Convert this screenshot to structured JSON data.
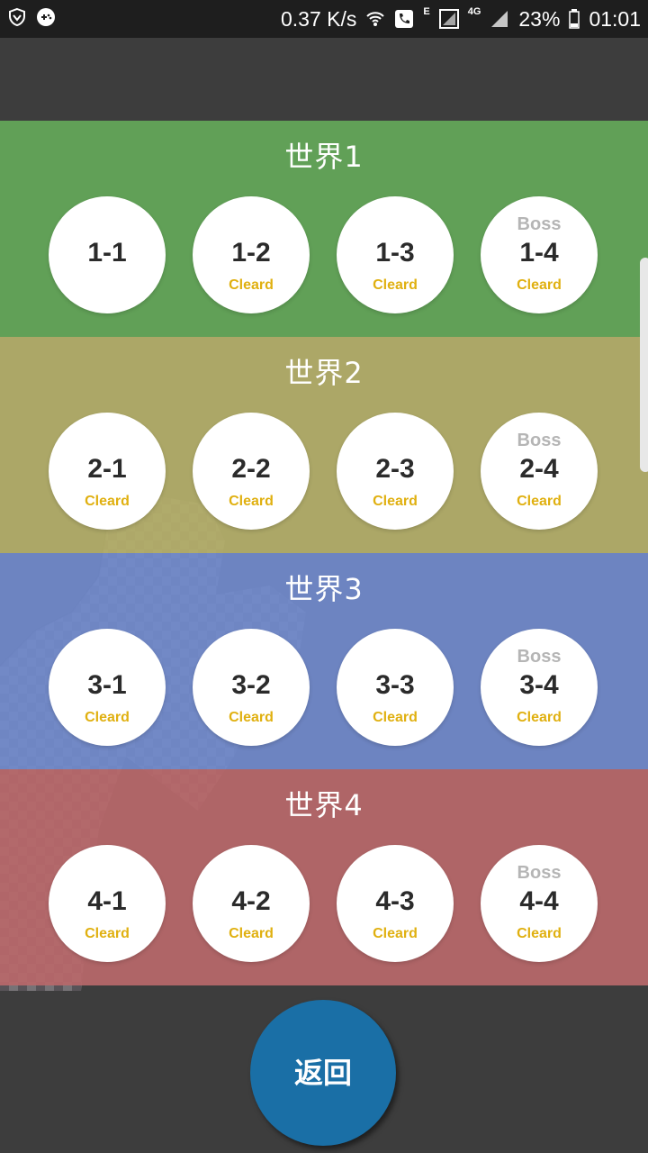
{
  "status_bar": {
    "net_speed": "0.37 K/s",
    "network_e": "E",
    "network_4g": "4G",
    "battery": "23%",
    "time": "01:01",
    "icons": [
      "shield-icon",
      "game-icon",
      "wifi-icon",
      "call-icon",
      "signal-icon",
      "signal-4g-icon",
      "battery-icon"
    ]
  },
  "colors": {
    "world1": "#61a057",
    "world2": "#b5b06a",
    "world3": "#728ccf",
    "world4": "#b8686a",
    "cleared": "#e0b010",
    "back_button": "#1a6fa6"
  },
  "worlds": [
    {
      "title": "世界1",
      "stages": [
        {
          "label": "1-1",
          "boss": "",
          "status": ""
        },
        {
          "label": "1-2",
          "boss": "",
          "status": "Cleard"
        },
        {
          "label": "1-3",
          "boss": "",
          "status": "Cleard"
        },
        {
          "label": "1-4",
          "boss": "Boss",
          "status": "Cleard"
        }
      ]
    },
    {
      "title": "世界2",
      "stages": [
        {
          "label": "2-1",
          "boss": "",
          "status": "Cleard"
        },
        {
          "label": "2-2",
          "boss": "",
          "status": "Cleard"
        },
        {
          "label": "2-3",
          "boss": "",
          "status": "Cleard"
        },
        {
          "label": "2-4",
          "boss": "Boss",
          "status": "Cleard"
        }
      ]
    },
    {
      "title": "世界3",
      "stages": [
        {
          "label": "3-1",
          "boss": "",
          "status": "Cleard"
        },
        {
          "label": "3-2",
          "boss": "",
          "status": "Cleard"
        },
        {
          "label": "3-3",
          "boss": "",
          "status": "Cleard"
        },
        {
          "label": "3-4",
          "boss": "Boss",
          "status": "Cleard"
        }
      ]
    },
    {
      "title": "世界4",
      "stages": [
        {
          "label": "4-1",
          "boss": "",
          "status": "Cleard"
        },
        {
          "label": "4-2",
          "boss": "",
          "status": "Cleard"
        },
        {
          "label": "4-3",
          "boss": "",
          "status": "Cleard"
        },
        {
          "label": "4-4",
          "boss": "Boss",
          "status": "Cleard"
        }
      ]
    }
  ],
  "back_button": {
    "label": "返回"
  }
}
